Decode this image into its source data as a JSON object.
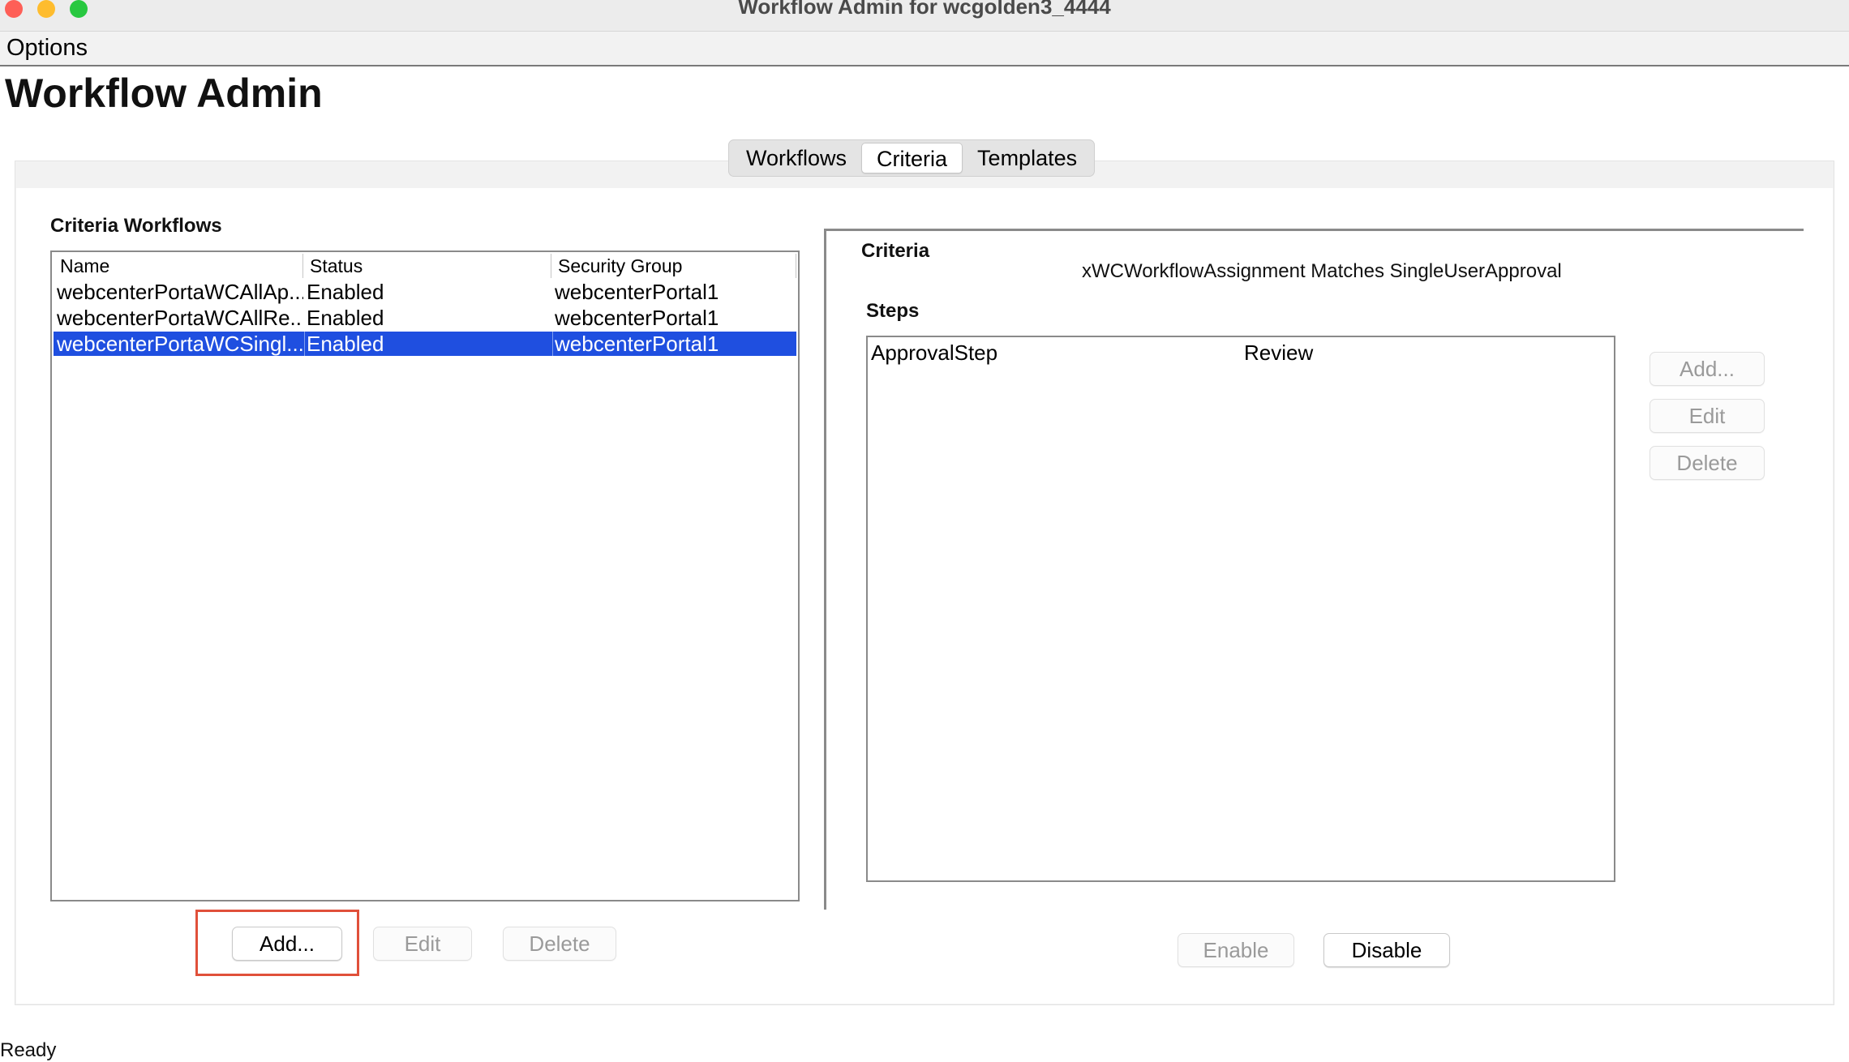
{
  "window": {
    "title": "Workflow Admin for wcgolden3_4444",
    "colors": {
      "close": "#fe5f57",
      "minimize": "#febc2e",
      "zoom": "#28c840"
    }
  },
  "menu": {
    "options": "Options"
  },
  "app": {
    "title": "Workflow Admin"
  },
  "tabs": [
    {
      "label": "Workflows",
      "active": false
    },
    {
      "label": "Criteria",
      "active": true
    },
    {
      "label": "Templates",
      "active": false
    }
  ],
  "criteria_workflows": {
    "label": "Criteria Workflows",
    "columns": [
      "Name",
      "Status",
      "Security Group"
    ],
    "rows": [
      {
        "name": "webcenterPortaWCAllAp...",
        "status": "Enabled",
        "security_group": "webcenterPortal1",
        "selected": false
      },
      {
        "name": "webcenterPortaWCAllRe...",
        "status": "Enabled",
        "security_group": "webcenterPortal1",
        "selected": false
      },
      {
        "name": "webcenterPortaWCSingl...",
        "status": "Enabled",
        "security_group": "webcenterPortal1",
        "selected": true
      }
    ],
    "buttons": {
      "add": "Add...",
      "edit": "Edit",
      "delete": "Delete"
    }
  },
  "criteria": {
    "label": "Criteria",
    "value": "xWCWorkflowAssignment Matches SingleUserApproval"
  },
  "steps": {
    "label": "Steps",
    "items": [
      {
        "name": "ApprovalStep",
        "type": "Review"
      }
    ],
    "buttons": {
      "add": "Add...",
      "edit": "Edit",
      "delete": "Delete"
    }
  },
  "workflow_buttons": {
    "enable": "Enable",
    "disable": "Disable"
  },
  "status_bar": {
    "text": "Ready"
  },
  "accent": {
    "selection": "#1f4fe0",
    "highlight_box": "#e0503a"
  }
}
